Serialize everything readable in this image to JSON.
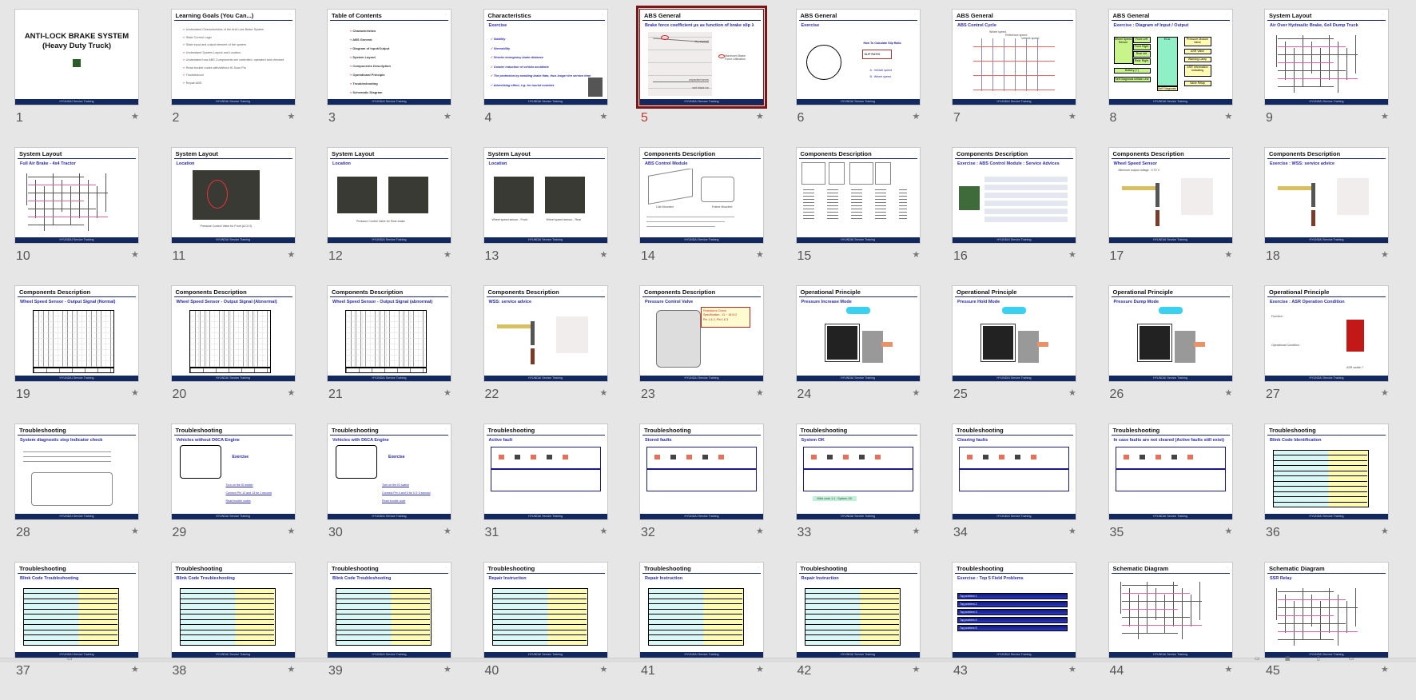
{
  "view": "Slide Sorter",
  "selected_slide": 5,
  "footer_text": "HYUNDAI Service Training",
  "colors": {
    "footer": "#12285e",
    "selection": "#7a1616",
    "subtitle": "#2a2ab0"
  },
  "slides": [
    {
      "num": "1",
      "kind": "title",
      "lines": [
        "ANTI-LOCK BRAKE SYSTEM",
        "(Heavy Duty Truck)"
      ]
    },
    {
      "num": "2",
      "title": "Learning Goals (You Can...)",
      "kind": "bullets",
      "items": [
        "Understand Characteristics of the Anti Lock Brake System",
        "State Control Logic",
        "State input and output element of the system",
        "Understand System Layout and Location",
        "Understand how ABS Components are controlled, operated and checked",
        "Read trouble codes with/without Hi-Scan Pro",
        "Troubleshoot",
        "Repair ABS"
      ]
    },
    {
      "num": "3",
      "title": "Table of Contents",
      "kind": "toc",
      "items": [
        "Characteristics",
        "ABS General",
        "Diagram of Input/Output",
        "System Layout",
        "Components Description",
        "Operational Principle",
        "Troubleshooting",
        "Schematic Diagram"
      ]
    },
    {
      "num": "4",
      "title": "Characteristics",
      "subtitle": "Exercise",
      "kind": "checks",
      "items": [
        "Stability",
        "Steerability",
        "Shorter emergency brake distance",
        "Greater reduction of vehicle accidents",
        "The protection by avoiding brake flats, thus longer tire service time",
        "Advertising effect, e.g. for tourist coaches"
      ]
    },
    {
      "num": "5",
      "title": "ABS General",
      "subtitle": "Brake force coefficient μs as function of brake slip λ",
      "kind": "chart",
      "items": [
        "dry asphalt",
        "unpacked snow",
        "wet black ice",
        "Maximum Brake Force Utilization"
      ]
    },
    {
      "num": "6",
      "title": "ABS General",
      "subtitle": "Exercise",
      "kind": "wheel",
      "items": [
        "How To Calculate Slip Ratio",
        "SLIP RATIO",
        "A : Vehicle speed",
        "B : Wheel speed"
      ]
    },
    {
      "num": "7",
      "title": "ABS General",
      "subtitle": "ABS Control Cycle",
      "kind": "cycle",
      "items": [
        "Wheel speed",
        "Reference speed",
        "Vehicle speed"
      ]
    },
    {
      "num": "8",
      "title": "ABS General",
      "subtitle": "Exercise : Diagram of Input / Output",
      "kind": "io",
      "items": [
        "Wheel Speed Sensor",
        "Front Left",
        "Front Right",
        "Rear left",
        "Rear Right",
        "Battery (+)",
        "Self Diagnosis Initiate Line",
        "ECU",
        "Self Diagnosis",
        "Pressure Module Valve",
        "ASR Valve",
        "Warning Lamp",
        "ASR Information Indicating",
        "Valve Relay"
      ]
    },
    {
      "num": "9",
      "title": "System Layout",
      "subtitle": "Air Over Hydraulic Brake, 6x4 Dump Truck",
      "kind": "schematic"
    },
    {
      "num": "10",
      "title": "System Layout",
      "subtitle": "Full Air Brake - 4x4 Tractor",
      "kind": "schematic"
    },
    {
      "num": "11",
      "title": "System Layout",
      "subtitle": "Location",
      "kind": "photo1",
      "items": [
        "Pressure Control Valve for Front (A.O.H)"
      ]
    },
    {
      "num": "12",
      "title": "System Layout",
      "subtitle": "Location",
      "kind": "photo2",
      "items": [
        "Pressure Control Valve for Rear brake"
      ]
    },
    {
      "num": "13",
      "title": "System Layout",
      "subtitle": "Location",
      "kind": "photo2",
      "items": [
        "Wheel speed sensor - Front",
        "Wheel speed sensor - Rear"
      ]
    },
    {
      "num": "14",
      "title": "Components Description",
      "subtitle": "ABS Control Module",
      "kind": "module",
      "items": [
        "Cab Mounted",
        "Frame Mounted"
      ]
    },
    {
      "num": "15",
      "title": "Components Description",
      "kind": "pins"
    },
    {
      "num": "16",
      "title": "Components Description",
      "subtitle": "Exercise : ABS Control Module : Service Advices",
      "kind": "advice"
    },
    {
      "num": "17",
      "title": "Components Description",
      "subtitle": "Wheel Speed Sensor",
      "kind": "sensor",
      "items": [
        "Minimum output voltage : 0.70 V"
      ]
    },
    {
      "num": "18",
      "title": "Components Description",
      "subtitle": "Exercise : WSS: service advice",
      "kind": "sensor"
    },
    {
      "num": "19",
      "title": "Components Description",
      "subtitle": "Wheel Speed Sensor - Output Signal (Normal)",
      "kind": "scope"
    },
    {
      "num": "20",
      "title": "Components Description",
      "subtitle": "Wheel Speed Sensor - Output Signal (Abnormal)",
      "kind": "scope"
    },
    {
      "num": "21",
      "title": "Components Description",
      "subtitle": "Wheel Speed Sensor - Output Signal (abnormal)",
      "kind": "scope"
    },
    {
      "num": "22",
      "title": "Components Description",
      "subtitle": "WSS: service advice",
      "kind": "sensor"
    },
    {
      "num": "23",
      "title": "Components Description",
      "subtitle": "Pressure Control Valve",
      "kind": "valve",
      "items": [
        "Resistance Check",
        "Specification : 11 ~ 16.5 Ω",
        "Pin 1 & 2,  Pin 1 & 3"
      ]
    },
    {
      "num": "24",
      "title": "Operational Principle",
      "subtitle": "Pressure Increase Mode",
      "kind": "mode"
    },
    {
      "num": "25",
      "title": "Operational Principle",
      "subtitle": "Pressure Hold Mode",
      "kind": "mode"
    },
    {
      "num": "26",
      "title": "Operational Principle",
      "subtitle": "Pressure Dump Mode",
      "kind": "mode"
    },
    {
      "num": "27",
      "title": "Operational Principle",
      "subtitle": "Exercise : ASR Operation Condition",
      "kind": "asr",
      "items": [
        "Function :",
        "Operational Condition :",
        "ASR switch ?"
      ]
    },
    {
      "num": "28",
      "title": "Troubleshooting",
      "subtitle": "System diagnostic step Indicator check",
      "kind": "cluster"
    },
    {
      "num": "29",
      "title": "Troubleshooting",
      "subtitle": "Vehicles without D6CA Engine",
      "kind": "steps",
      "items": [
        "Exercise",
        "Turn on the IG switch",
        "Connect Pin 12 and 13 for 1 second",
        "Read trouble codes"
      ]
    },
    {
      "num": "30",
      "title": "Troubleshooting",
      "subtitle": "Vehicles with D6CA Engine",
      "kind": "steps",
      "items": [
        "Exercise",
        "Turn on the IG switch",
        "Connect Pin 4 and 5 for 0.3~3 second",
        "Read trouble code"
      ]
    },
    {
      "num": "31",
      "title": "Troubleshooting",
      "subtitle": "Active fault",
      "kind": "blink"
    },
    {
      "num": "32",
      "title": "Troubleshooting",
      "subtitle": "Stored faults",
      "kind": "blink"
    },
    {
      "num": "33",
      "title": "Troubleshooting",
      "subtitle": "System OK",
      "kind": "blink",
      "items": [
        "Blink code 1-1 : System OK"
      ]
    },
    {
      "num": "34",
      "title": "Troubleshooting",
      "subtitle": "Clearing faults",
      "kind": "blink"
    },
    {
      "num": "35",
      "title": "Troubleshooting",
      "subtitle": "In case faults are not cleared (Active faults still exist)",
      "kind": "blink"
    },
    {
      "num": "36",
      "title": "Troubleshooting",
      "subtitle": "Blink Code Identification",
      "kind": "table"
    },
    {
      "num": "37",
      "title": "Troubleshooting",
      "subtitle": "Blink Code Troubleshooting",
      "kind": "table"
    },
    {
      "num": "38",
      "title": "Troubleshooting",
      "subtitle": "Blink Code Troubleshooting",
      "kind": "table"
    },
    {
      "num": "39",
      "title": "Troubleshooting",
      "subtitle": "Blink Code Troubleshooting",
      "kind": "table"
    },
    {
      "num": "40",
      "title": "Troubleshooting",
      "subtitle": "Repair Instruction",
      "kind": "table"
    },
    {
      "num": "41",
      "title": "Troubleshooting",
      "subtitle": "Repair Instruction",
      "kind": "table"
    },
    {
      "num": "42",
      "title": "Troubleshooting",
      "subtitle": "Repair Instruction",
      "kind": "table"
    },
    {
      "num": "43",
      "title": "Troubleshooting",
      "subtitle": "Exercise : Top 5 Field Problems",
      "kind": "problems",
      "items": [
        "Top problem 1",
        "Top problem 2",
        "Top problem 3",
        "Top problem 4",
        "Top problem 5"
      ]
    },
    {
      "num": "44",
      "title": "Schematic Diagram",
      "kind": "wiring"
    },
    {
      "num": "45",
      "title": "Schematic Diagram",
      "subtitle": "SSR Relay",
      "kind": "wiring"
    }
  ]
}
